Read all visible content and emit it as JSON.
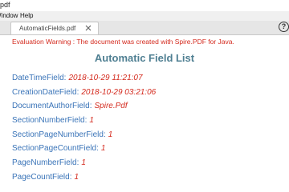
{
  "window": {
    "title_fragment": "pdf"
  },
  "menubar": {
    "items": [
      "Window",
      "Help"
    ]
  },
  "tab": {
    "label": "AutomaticFields.pdf"
  },
  "help": {
    "label": "?"
  },
  "document": {
    "warning": "Evaluation Warning : The document was created with Spire.PDF for Java.",
    "title": "Automatic Field List",
    "fields": [
      {
        "name": "DateTimeField:",
        "value": "2018-10-29 11:21:07"
      },
      {
        "name": "CreationDateField:",
        "value": "2018-10-29 03:21:06"
      },
      {
        "name": "DocumentAuthorField:",
        "value": "Spire.Pdf"
      },
      {
        "name": "SectionNumberField:",
        "value": "1"
      },
      {
        "name": "SectionPageNumberField:",
        "value": "1"
      },
      {
        "name": "SectionPageCountField:",
        "value": "1"
      },
      {
        "name": "PageNumberField:",
        "value": "1"
      },
      {
        "name": "PageCountField:",
        "value": "1"
      }
    ]
  },
  "colors": {
    "warning": "#d42a1e",
    "title": "#4f7f92",
    "field_name": "#3a74b8",
    "field_value": "#d42a1e"
  }
}
